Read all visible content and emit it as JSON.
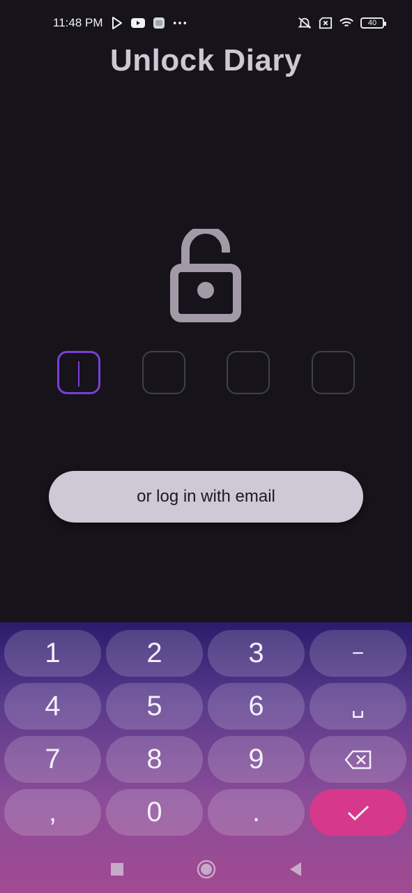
{
  "status_bar": {
    "time": "11:48 PM",
    "left_icons": [
      "play-store-icon",
      "youtube-icon",
      "app-icon",
      "more-dots-icon"
    ],
    "right_icons": [
      "mute-icon",
      "no-sim-icon",
      "wifi-icon",
      "battery-icon"
    ],
    "battery_level": "40"
  },
  "title": "Unlock Diary",
  "lock_icon": "lock-open-icon",
  "pin": {
    "digits": 4,
    "active_index": 0,
    "active_color": "#7c3ed9"
  },
  "email_button_label": "or log in with email",
  "keyboard": {
    "keys": [
      "1",
      "2",
      "3",
      "−",
      "4",
      "5",
      "6",
      "␣",
      "7",
      "8",
      "9",
      "backspace",
      ",",
      "0",
      ".",
      "enter"
    ],
    "enter_color": "#d6388b"
  },
  "navbar": [
    "recents-icon",
    "home-icon",
    "back-icon"
  ]
}
